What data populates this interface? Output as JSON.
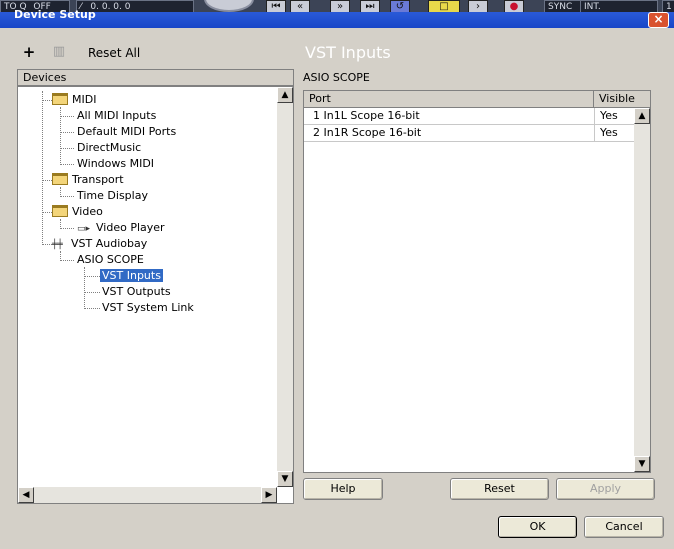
{
  "window": {
    "title": "Device Setup",
    "close_glyph": "×"
  },
  "transport": {
    "quantize": "TO Q",
    "quantize_value": "OFF",
    "position": "0. 0. 0.  0",
    "sync_label": "SYNC",
    "sync_value": "INT.",
    "right_edge": "1"
  },
  "toolbar": {
    "add_icon": "plus-icon",
    "remove_icon": "trash-icon",
    "reset_all_label": "Reset All"
  },
  "tree": {
    "header": "Devices",
    "nodes": [
      {
        "label": "MIDI",
        "type": "folder"
      },
      {
        "label": "All MIDI Inputs"
      },
      {
        "label": "Default MIDI Ports"
      },
      {
        "label": "DirectMusic"
      },
      {
        "label": "Windows MIDI"
      },
      {
        "label": "Transport",
        "type": "folder"
      },
      {
        "label": "Time Display"
      },
      {
        "label": "Video",
        "type": "folder"
      },
      {
        "label": "Video Player"
      },
      {
        "label": "VST Audiobay"
      },
      {
        "label": "ASIO SCOPE"
      },
      {
        "label": "VST Inputs",
        "selected": true
      },
      {
        "label": "VST Outputs"
      },
      {
        "label": "VST System Link"
      }
    ]
  },
  "panel": {
    "title": "VST Inputs",
    "device": "ASIO SCOPE",
    "columns": {
      "port": "Port",
      "visible": "Visible"
    },
    "rows": [
      {
        "port": "1 In1L Scope 16-bit",
        "visible": "Yes"
      },
      {
        "port": "2 In1R Scope 16-bit",
        "visible": "Yes"
      }
    ]
  },
  "buttons": {
    "help": "Help",
    "reset": "Reset",
    "apply": "Apply",
    "ok": "OK",
    "cancel": "Cancel"
  },
  "colors": {
    "selection": "#316ac5",
    "titlebar": "#1846c8",
    "panel_title": "#ffffff"
  }
}
